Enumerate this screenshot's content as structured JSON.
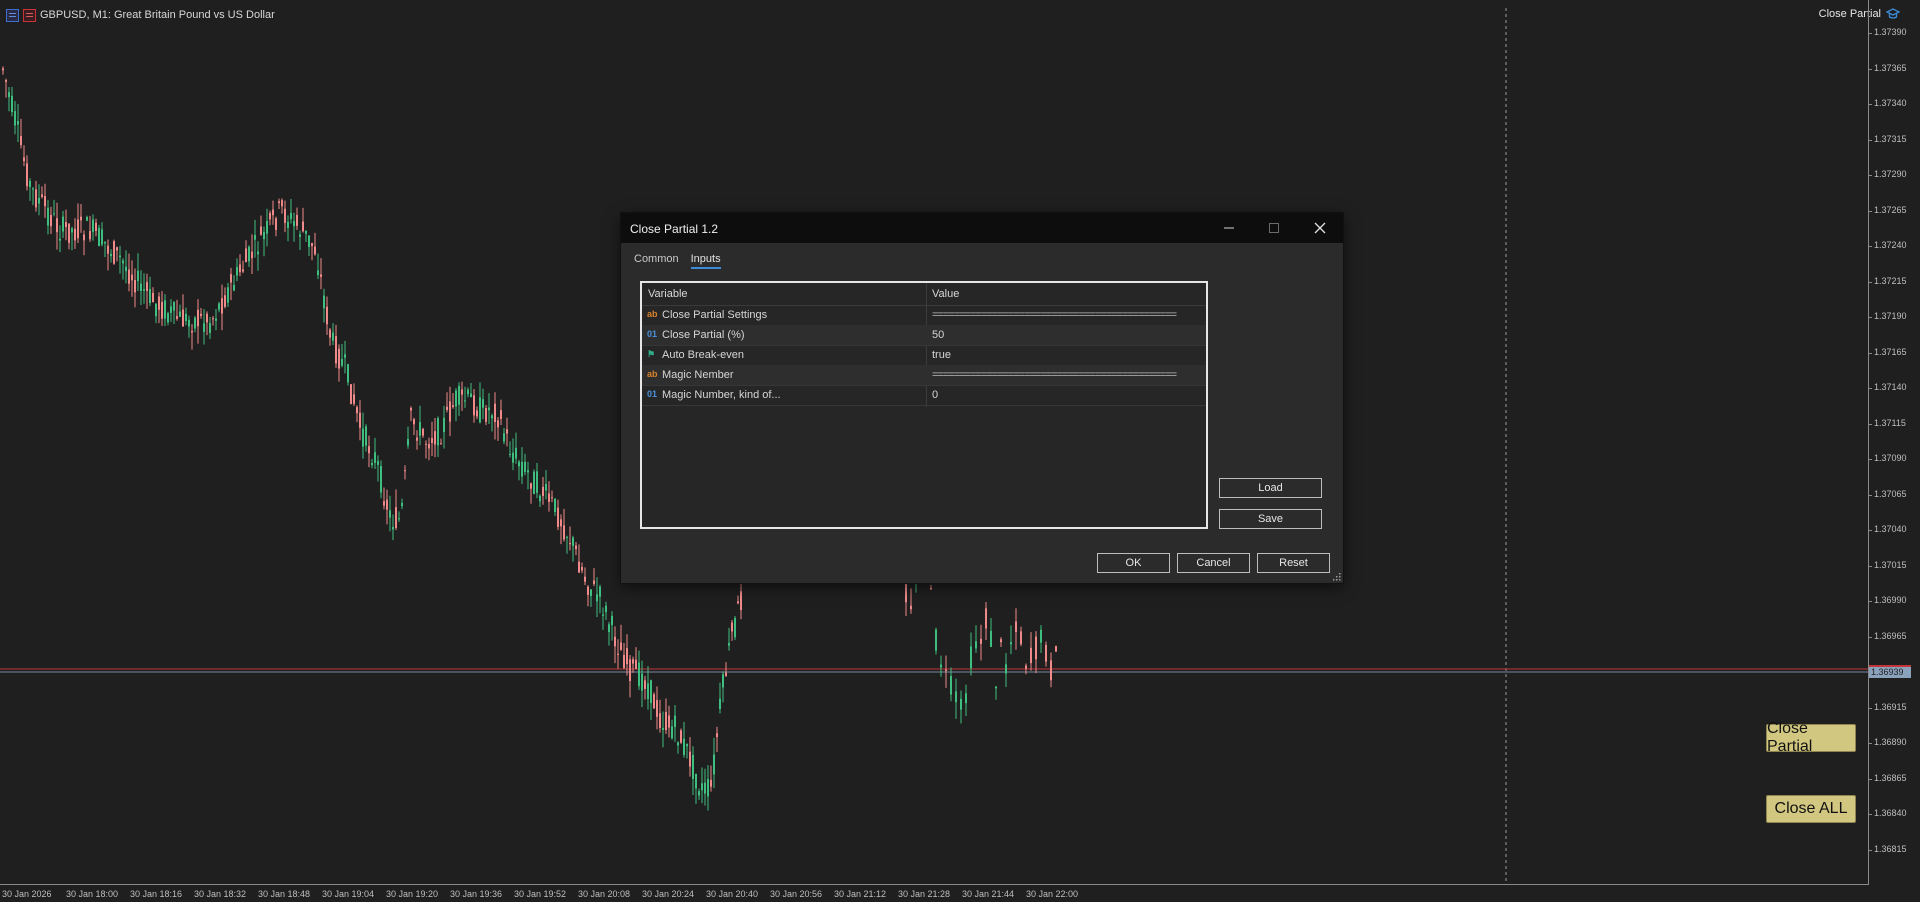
{
  "chart": {
    "symbol": "GBPUSD, M1:  Great Britain Pound vs US Dollar",
    "ea_name": "Close Partial",
    "current_price": "1.36939",
    "price_axis": [
      "1.37390",
      "1.37365",
      "1.37340",
      "1.37315",
      "1.37290",
      "1.37265",
      "1.37240",
      "1.37215",
      "1.37190",
      "1.37165",
      "1.37140",
      "1.37115",
      "1.37090",
      "1.37065",
      "1.37040",
      "1.37015",
      "1.36990",
      "1.36965",
      "1.36939",
      "1.36915",
      "1.36890",
      "1.36865",
      "1.36840",
      "1.36815"
    ],
    "time_axis": [
      "30 Jan 2026",
      "30 Jan 18:00",
      "30 Jan 18:16",
      "30 Jan 18:32",
      "30 Jan 18:48",
      "30 Jan 19:04",
      "30 Jan 19:20",
      "30 Jan 19:36",
      "30 Jan 19:52",
      "30 Jan 20:08",
      "30 Jan 20:24",
      "30 Jan 20:40",
      "30 Jan 20:56",
      "30 Jan 21:12",
      "30 Jan 21:28",
      "30 Jan 21:44",
      "30 Jan 22:00"
    ],
    "colors": {
      "bull": "#3fbf7f",
      "bear": "#f08a8a",
      "background": "#1f1f1f",
      "price_line": "#c0343a"
    }
  },
  "buttons": {
    "close_partial": "Close Partial",
    "close_all": "Close ALL"
  },
  "dialog": {
    "title": "Close Partial 1.2",
    "tabs": [
      {
        "label": "Common"
      },
      {
        "label": "Inputs"
      }
    ],
    "active_tab": "Inputs",
    "table": {
      "col_variable": "Variable",
      "col_value": "Value",
      "rows": [
        {
          "icon": "ab",
          "icon_name": "string-type-icon",
          "name": "Close Partial Settings",
          "value": "============================================="
        },
        {
          "icon": "01",
          "icon_name": "number-type-icon",
          "name": "Close Partial (%)",
          "value": "50"
        },
        {
          "icon": "⚑",
          "icon_name": "bool-type-icon",
          "name": "Auto Break-even",
          "value": "true"
        },
        {
          "icon": "ab",
          "icon_name": "string-type-icon",
          "name": "Magic Nember",
          "value": "============================================="
        },
        {
          "icon": "01",
          "icon_name": "number-type-icon",
          "name": "Magic Number, kind of...",
          "value": "0"
        }
      ]
    },
    "buttons": {
      "load": "Load",
      "save": "Save",
      "ok": "OK",
      "cancel": "Cancel",
      "reset": "Reset"
    }
  }
}
